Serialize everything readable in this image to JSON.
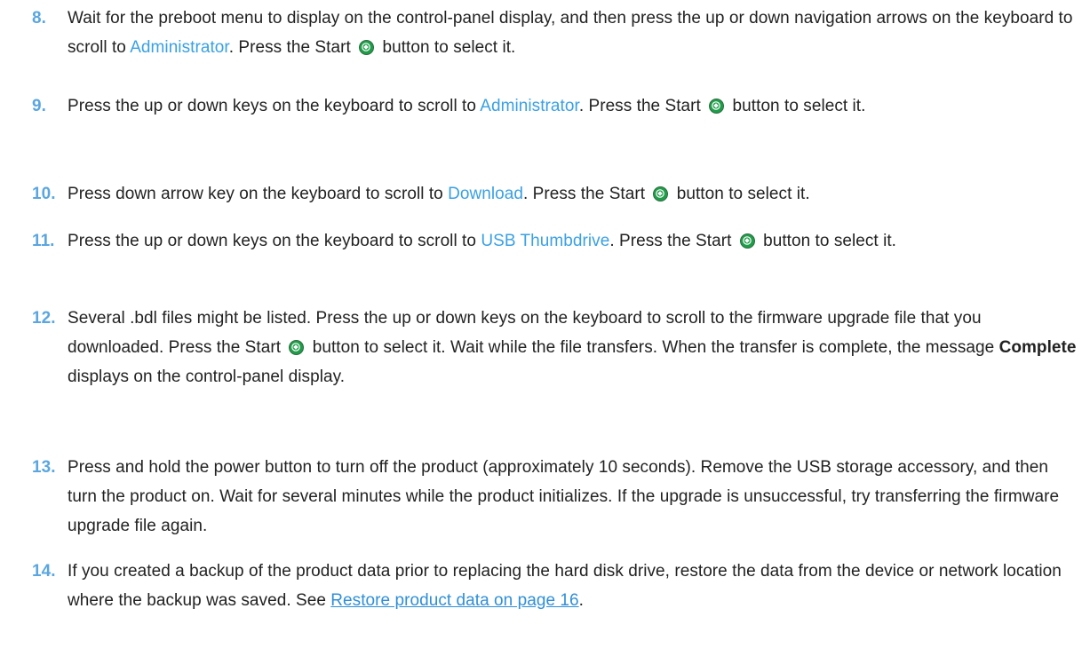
{
  "steps": [
    {
      "number": "8.",
      "parts": {
        "a": "Wait for the preboot menu to display on the control-panel display, and then press the up or down navigation arrows on the keyboard to scroll to ",
        "b": "Administrator",
        "c": ". Press the Start ",
        "d": " button to select it."
      }
    },
    {
      "number": "9.",
      "parts": {
        "a": "Press the up or down keys on the keyboard to scroll to ",
        "b": "Administrator",
        "c": ". Press the Start ",
        "d": " button to select it."
      }
    },
    {
      "number": "10.",
      "parts": {
        "a": "Press down arrow key on the keyboard to scroll to ",
        "b": "Download",
        "c": ". Press the Start ",
        "d": " button to select it."
      }
    },
    {
      "number": "11.",
      "parts": {
        "a": "Press the up or down keys on the keyboard to scroll to ",
        "b": "USB Thumbdrive",
        "c": ". Press the Start ",
        "d": " button to select it."
      }
    },
    {
      "number": "12.",
      "parts": {
        "a": "Several .bdl files might be listed. Press the up or down keys on the keyboard to scroll to the firmware upgrade file that you downloaded. Press the Start ",
        "b": " button to select it. Wait while the file transfers. When the transfer is complete, the message ",
        "c": "Complete",
        "d": " displays on the control-panel display."
      }
    },
    {
      "number": "13.",
      "text": "Press and hold the power button to turn off the product (approximately 10 seconds). Remove the USB storage accessory, and then turn the product on. Wait for several minutes while the product initializes. If the upgrade is unsuccessful, try transferring the firmware upgrade file again."
    },
    {
      "number": "14.",
      "parts": {
        "a": "If you created a backup of the product data prior to replacing the hard disk drive, restore the data from the device or network location where the backup was saved. See ",
        "link": "Restore product data on page 16",
        "c": "."
      }
    }
  ],
  "icons": {
    "start_button": "start-button-icon"
  },
  "colors": {
    "step_number": "#5aa6e0",
    "highlight": "#3aa0e4",
    "link": "#2f8fd8",
    "start_icon": "#1f9e4a"
  }
}
